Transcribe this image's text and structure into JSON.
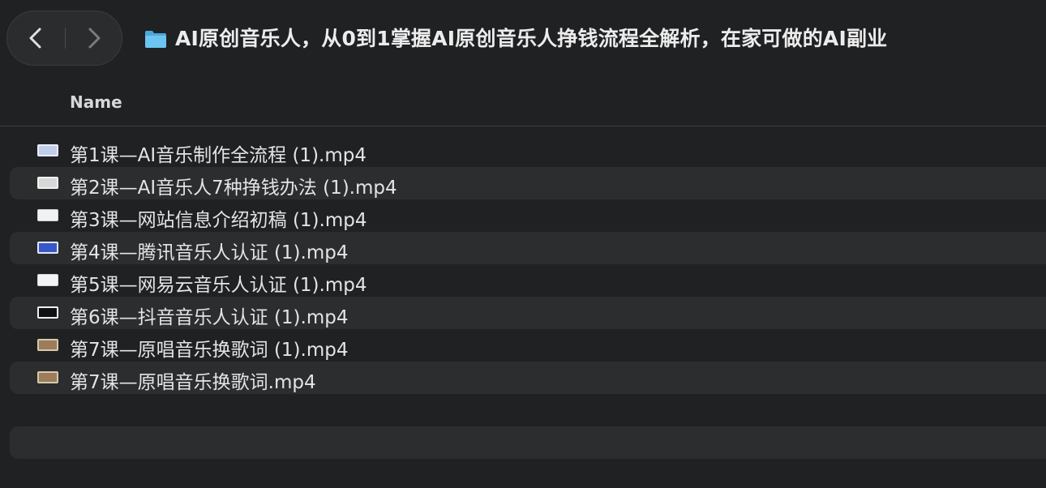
{
  "toolbar": {
    "back_icon": "chevron-left-icon",
    "forward_icon": "chevron-right-icon",
    "folder_icon": "folder-icon",
    "folder_color": "#5ab8e8",
    "title": "AI原创音乐人，从0到1掌握AI原创音乐人挣钱流程全解析，在家可做的AI副业"
  },
  "columns": {
    "name": "Name"
  },
  "files": [
    {
      "name": "第1课—AI音乐制作全流程 (1).mp4",
      "thumb_color": "#b9c6e8"
    },
    {
      "name": "第2课—AI音乐人7种挣钱办法 (1).mp4",
      "thumb_color": "#e8e8e8"
    },
    {
      "name": "第3课—网站信息介绍初稿 (1).mp4",
      "thumb_color": "#f2f2f2"
    },
    {
      "name": "第4课—腾讯音乐人认证 (1).mp4",
      "thumb_color": "#3a56c8"
    },
    {
      "name": "第5课—网易云音乐人认证 (1).mp4",
      "thumb_color": "#f4f4f4"
    },
    {
      "name": "第6课—抖音音乐人认证 (1).mp4",
      "thumb_color": "#111111"
    },
    {
      "name": "第7课—原唱音乐换歌词 (1).mp4",
      "thumb_color": "#a08060"
    },
    {
      "name": "第7课—原唱音乐换歌词.mp4",
      "thumb_color": "#a08060"
    }
  ]
}
